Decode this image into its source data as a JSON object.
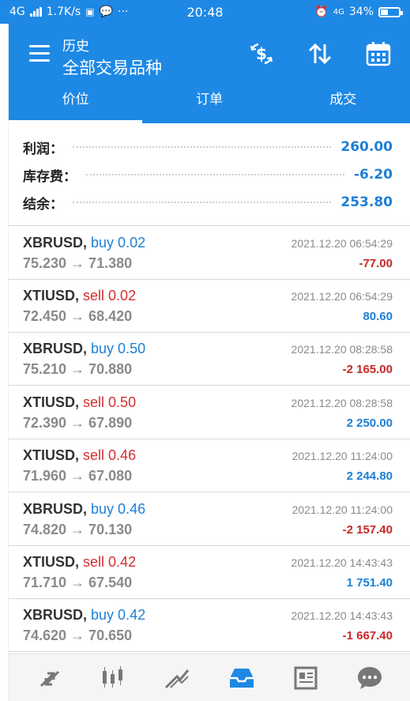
{
  "status_bar": {
    "network": "4G",
    "speed": "1.7K/s",
    "time": "20:48",
    "battery": "34%",
    "net_right": "4G"
  },
  "header": {
    "subtitle": "历史",
    "title": "全部交易品种"
  },
  "tabs": [
    {
      "label": "价位",
      "active": true
    },
    {
      "label": "订单",
      "active": false
    },
    {
      "label": "成交",
      "active": false
    }
  ],
  "summary": {
    "profit_label": "利润：",
    "profit_value": "260.00",
    "storage_label": "库存费：",
    "storage_value": "-6.20",
    "balance_label": "结余：",
    "balance_value": "253.80"
  },
  "deals": [
    {
      "symbol": "XBRUSD,",
      "side": "buy 0.02",
      "type": "buy",
      "prices": "75.230 → 71.380",
      "time": "2021.12.20 06:54:29",
      "profit": "-77.00"
    },
    {
      "symbol": "XTIUSD,",
      "side": "sell 0.02",
      "type": "sell",
      "prices": "72.450 → 68.420",
      "time": "2021.12.20 06:54:29",
      "profit": "80.60"
    },
    {
      "symbol": "XBRUSD,",
      "side": "buy 0.50",
      "type": "buy",
      "prices": "75.210 → 70.880",
      "time": "2021.12.20 08:28:58",
      "profit": "-2 165.00"
    },
    {
      "symbol": "XTIUSD,",
      "side": "sell 0.50",
      "type": "sell",
      "prices": "72.390 → 67.890",
      "time": "2021.12.20 08:28:58",
      "profit": "2 250.00"
    },
    {
      "symbol": "XTIUSD,",
      "side": "sell 0.46",
      "type": "sell",
      "prices": "71.960 → 67.080",
      "time": "2021.12.20 11:24:00",
      "profit": "2 244.80"
    },
    {
      "symbol": "XBRUSD,",
      "side": "buy 0.46",
      "type": "buy",
      "prices": "74.820 → 70.130",
      "time": "2021.12.20 11:24:00",
      "profit": "-2 157.40"
    },
    {
      "symbol": "XTIUSD,",
      "side": "sell 0.42",
      "type": "sell",
      "prices": "71.710 → 67.540",
      "time": "2021.12.20 14:43:43",
      "profit": "1 751.40"
    },
    {
      "symbol": "XBRUSD,",
      "side": "buy 0.42",
      "type": "buy",
      "prices": "74.620 → 70.650",
      "time": "2021.12.20 14:43:43",
      "profit": "-1 667.40"
    }
  ],
  "bottom_nav": [
    {
      "icon": "quotes-icon"
    },
    {
      "icon": "chart-icon"
    },
    {
      "icon": "trade-icon"
    },
    {
      "icon": "history-icon",
      "active": true
    },
    {
      "icon": "news-icon"
    },
    {
      "icon": "messages-icon"
    }
  ],
  "colors": {
    "primary": "#1e88e5",
    "buy": "#1e7fd6",
    "sell": "#d32f2f"
  }
}
